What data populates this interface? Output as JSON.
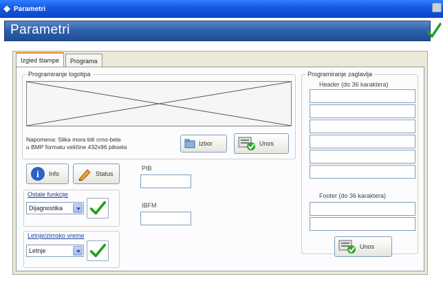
{
  "window": {
    "title": "Parametri"
  },
  "header": {
    "heading": "Parametri"
  },
  "tabs": [
    {
      "label": "Izgled štampe",
      "active": true
    },
    {
      "label": "Programa",
      "active": false
    }
  ],
  "logo_group": {
    "label": "Programiranje logotipa",
    "note_line1": "Napomena: Slika mora biti crno-bela",
    "note_line2": "u BMP formatu veličine 432x96 piksela",
    "izbor_button": "Izbor",
    "unos_button": "Unos"
  },
  "info_button": "Info",
  "status_button": "Status",
  "pib": {
    "label": "PIB",
    "value": ""
  },
  "ibfm": {
    "label": "IBFM",
    "value": ""
  },
  "ostale_funkcije": {
    "label": "Ostale funkcije",
    "selected": "Dijagnostika"
  },
  "letnje_zimsko": {
    "label": "Letnje/zimsko vreme",
    "selected": "Letnje"
  },
  "header_group": {
    "label": "Programiranje zaglavlja",
    "header_label": "Header (do 36 karaktera)",
    "header_lines": [
      "",
      "",
      "",
      "",
      "",
      ""
    ],
    "footer_label": "Footer (do 36 karaktera)",
    "footer_lines": [
      "",
      ""
    ],
    "unos_button": "Unos"
  },
  "colors": {
    "accent": "#2d5fa8",
    "check": "#22a022",
    "tab_highlight": "#e68b2c"
  }
}
